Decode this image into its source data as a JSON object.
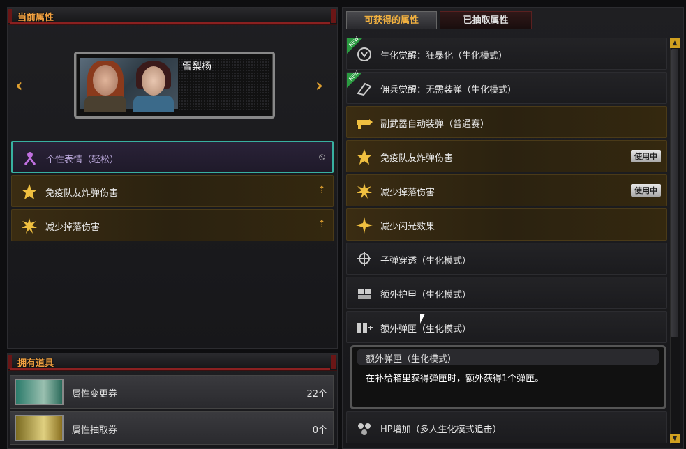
{
  "left_panel": {
    "title": "当前属性",
    "character": {
      "name": "雪梨杨"
    },
    "prev_arrow": "‹",
    "next_arrow": "›",
    "attributes": [
      {
        "label": "个性表情（轻松）",
        "end_icon": "⦸",
        "style": "selected"
      },
      {
        "label": "免疫队友炸弹伤害",
        "end_icon": "⇡",
        "style": "gold"
      },
      {
        "label": "减少掉落伤害",
        "end_icon": "⇡",
        "style": "gold"
      }
    ]
  },
  "items_panel": {
    "title": "拥有道具",
    "items": [
      {
        "label": "属性变更券",
        "count": "22个"
      },
      {
        "label": "属性抽取券",
        "count": "0个"
      }
    ]
  },
  "right_panel": {
    "tabs": [
      {
        "label": "可获得的属性",
        "active": true
      },
      {
        "label": "已抽取属性",
        "active": false
      }
    ],
    "attributes": [
      {
        "label": "生化觉醒：狂暴化（生化模式）",
        "style": "plain",
        "new": true,
        "new_text": "NEW"
      },
      {
        "label": "佣兵觉醒：无需装弹（生化模式）",
        "style": "plain",
        "new": true,
        "new_text": "NEW"
      },
      {
        "label": "副武器自动装弹（普通赛）",
        "style": "gold"
      },
      {
        "label": "免疫队友炸弹伤害",
        "style": "gold",
        "badge": "使用中"
      },
      {
        "label": "减少掉落伤害",
        "style": "gold",
        "badge": "使用中"
      },
      {
        "label": "减少闪光效果",
        "style": "gold"
      },
      {
        "label": "子弹穿透（生化模式）",
        "style": "plain"
      },
      {
        "label": "额外护甲（生化模式）",
        "style": "plain"
      },
      {
        "label": "额外弹匣（生化模式）",
        "style": "plain"
      }
    ],
    "tooltip": {
      "title": "额外弹匣（生化模式）",
      "description": "在补给箱里获得弹匣时，额外获得1个弹匣。"
    },
    "last_item": {
      "label": "HP增加（多人生化模式追击）"
    },
    "scroll_up": "▲",
    "scroll_down": "▼"
  }
}
